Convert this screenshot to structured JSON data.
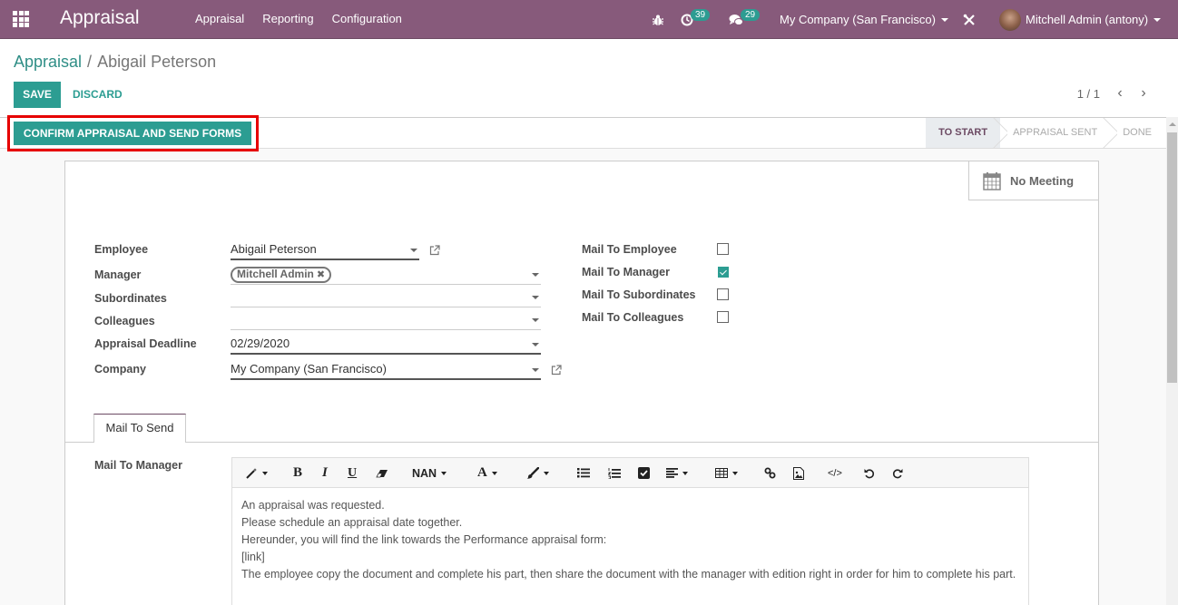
{
  "navbar": {
    "app_title": "Appraisal",
    "menu": [
      "Appraisal",
      "Reporting",
      "Configuration"
    ],
    "activity_count": "39",
    "message_count": "29",
    "company": "My Company (San Francisco)",
    "user": "Mitchell Admin (antony)",
    "color": "#875a7b"
  },
  "breadcrumb": {
    "parent": "Appraisal",
    "separator": "/",
    "current": "Abigail Peterson"
  },
  "actions": {
    "save": "SAVE",
    "discard": "DISCARD"
  },
  "pager": {
    "value": "1 / 1",
    "prev": "‹",
    "next": "›"
  },
  "statusbar": {
    "confirm_button": "CONFIRM APPRAISAL AND SEND FORMS",
    "stages": [
      {
        "label": "TO START",
        "active": true
      },
      {
        "label": "APPRAISAL SENT",
        "active": false
      },
      {
        "label": "DONE",
        "active": false
      }
    ]
  },
  "smart_button": {
    "label": "No Meeting"
  },
  "form": {
    "left_fields": [
      {
        "label": "Employee",
        "value": "Abigail Peterson"
      },
      {
        "label": "Manager",
        "tags": [
          "Mitchell Admin"
        ]
      },
      {
        "label": "Subordinates",
        "value": ""
      },
      {
        "label": "Colleagues",
        "value": ""
      },
      {
        "label": "Appraisal Deadline",
        "value": "02/29/2020"
      },
      {
        "label": "Company",
        "value": "My Company (San Francisco)"
      }
    ],
    "right_fields": [
      {
        "label": "Mail To Employee",
        "checked": false
      },
      {
        "label": "Mail To Manager",
        "checked": true
      },
      {
        "label": "Mail To Subordinates",
        "checked": false
      },
      {
        "label": "Mail To Colleagues",
        "checked": false
      }
    ]
  },
  "tabs": [
    {
      "label": "Mail To Send",
      "active": true
    }
  ],
  "mail_section": {
    "label": "Mail To Manager",
    "toolbar": {
      "font_size": "NAN",
      "items": [
        "magic-wand",
        "bold",
        "italic",
        "underline",
        "eraser",
        "font-size",
        "font-color",
        "paint-brush",
        "unordered-list",
        "ordered-list",
        "checklist",
        "align",
        "table",
        "link",
        "image",
        "code-view",
        "undo",
        "redo"
      ]
    },
    "lines": [
      "An appraisal was requested.",
      "Please schedule an appraisal date together.",
      "Hereunder, you will find the link towards the Performance appraisal form:",
      "[link]",
      "The employee copy the document and complete his part, then share the document with the manager with edition right in order for him to complete his part."
    ]
  }
}
